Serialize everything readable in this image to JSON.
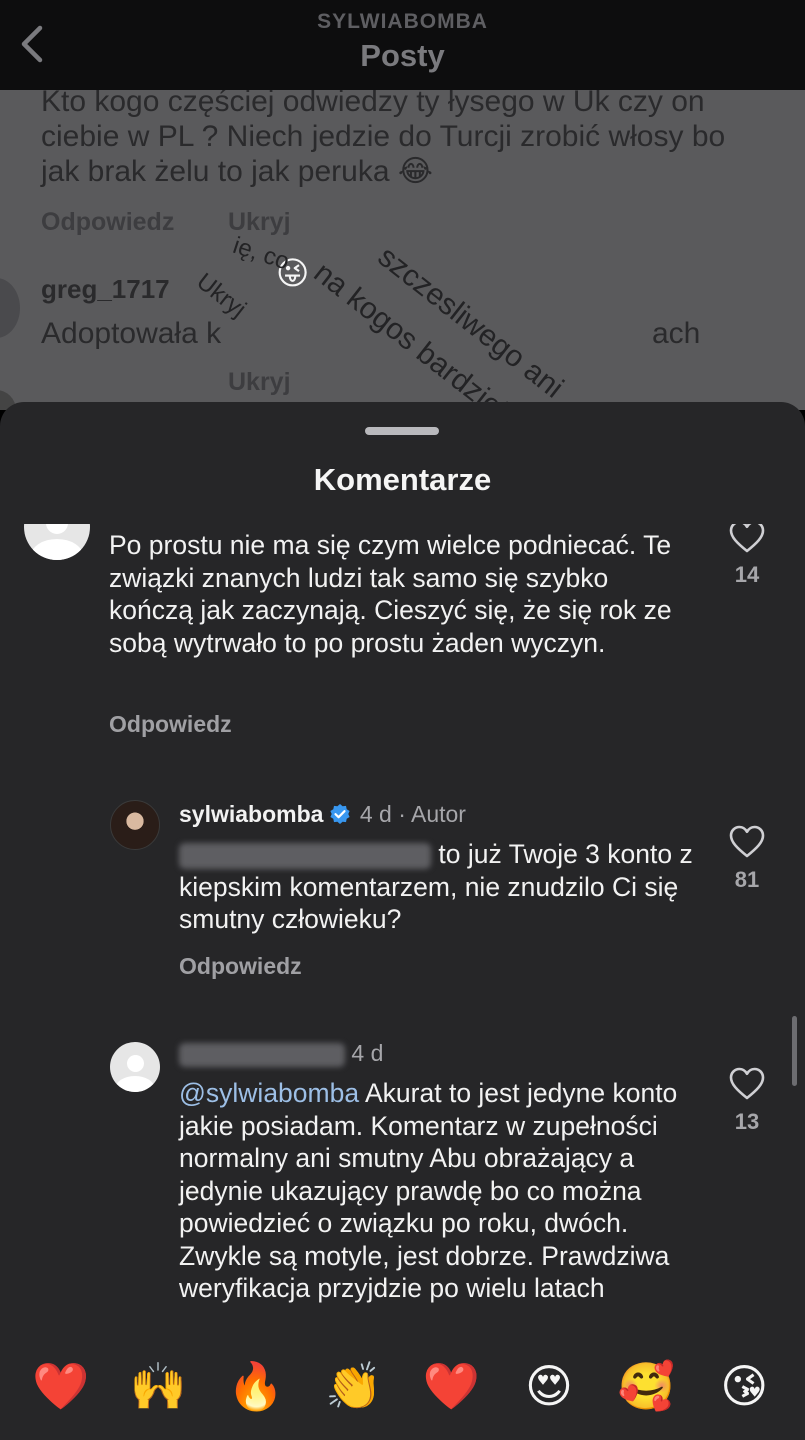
{
  "header": {
    "username": "SYLWIABOMBA",
    "title": "Posty"
  },
  "background": {
    "comment_text": "Kto kogo częściej odwiedzy ty łysego w Uk czy on ciebie w PL ? Niech jedzie do Turcji zrobić włosy bo jak brak żelu to jak peruka 😂",
    "reply_label": "Odpowiedz",
    "hide_label": "Ukryj",
    "next_user": "greg_1717",
    "next_text_start": "Adoptowała k",
    "next_text_end": "ach",
    "emoji": "😜",
    "overlay_text_1": "na kogos bardziej",
    "overlay_text_2": "szczesliwego ani",
    "overlay_hide": "Ukryj",
    "overlay_partial": "ię, co",
    "partial_hide": "Ukryj"
  },
  "sheet": {
    "title": "Komentarze"
  },
  "comments": [
    {
      "text": "Po prostu nie ma się czym wielce podniecać. Te związki znanych ludzi tak samo się szybko kończą jak zaczynają. Cieszyć się, że się rok ze sobą wytrwało to po prostu żaden wyczyn.",
      "reply_label": "Odpowiedz",
      "likes": "14"
    },
    {
      "username": "sylwiabomba",
      "time": "4 d",
      "author_label": "· Autor",
      "text": "to już Twoje 3 konto z kiepskim komentarzem, nie znudzilo Ci się smutny człowieku?",
      "reply_label": "Odpowiedz",
      "likes": "81"
    },
    {
      "time": "4 d",
      "mention": "@sylwiabomba",
      "text": "Akurat to jest jedyne konto jakie posiadam. Komentarz w zupełności normalny ani smutny Abu obrażający a jedynie ukazujący prawdę bo co można powiedzieć o związku po roku, dwóch. Zwykle są motyle, jest dobrze. Prawdziwa weryfikacja przyjdzie po wielu latach",
      "likes": "13"
    }
  ],
  "emoji_bar": [
    "❤️",
    "🙌",
    "🔥",
    "👏",
    "❤️",
    "😍",
    "🥰",
    "😘"
  ],
  "colors": {
    "sheet_bg": "#262628",
    "verified_badge": "#3897f0",
    "mention": "#9dbfe6"
  }
}
